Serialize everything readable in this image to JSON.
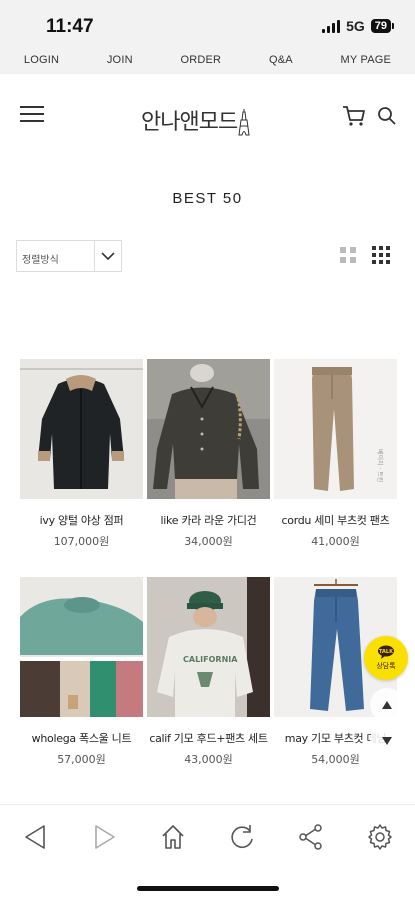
{
  "status_bar": {
    "time": "11:47",
    "network": "5G",
    "battery": "79"
  },
  "top_nav": [
    {
      "label": "LOGIN"
    },
    {
      "label": "JOIN"
    },
    {
      "label": "ORDER"
    },
    {
      "label": "Q&A"
    },
    {
      "label": "MY PAGE"
    }
  ],
  "header": {
    "logo": "안나앤모드"
  },
  "section": {
    "title": "BEST 50"
  },
  "sort": {
    "selected": "정렬방식"
  },
  "products": [
    {
      "name": "ivy 양털 야상 점퍼",
      "price": "107,000원"
    },
    {
      "name": "like 카라 라운 가디건",
      "price": "34,000원"
    },
    {
      "name": "cordu 세미 부츠컷 팬츠",
      "price": "41,000원"
    },
    {
      "name": "wholega 폭스울 니트",
      "price": "57,000원"
    },
    {
      "name": "calif 기모 후드+팬츠 세트",
      "price": "43,000원"
    },
    {
      "name": "may 기모 부츠컷 데님",
      "price": "54,000원"
    }
  ],
  "floating": {
    "kakao_label": "상담톡"
  },
  "colors": {
    "status_bg": "#f2f2f2",
    "kakao": "#f9e000",
    "text": "#222222"
  },
  "bottom_bar_icons": [
    "back-icon",
    "forward-icon",
    "home-icon",
    "refresh-icon",
    "share-icon",
    "settings-icon"
  ]
}
